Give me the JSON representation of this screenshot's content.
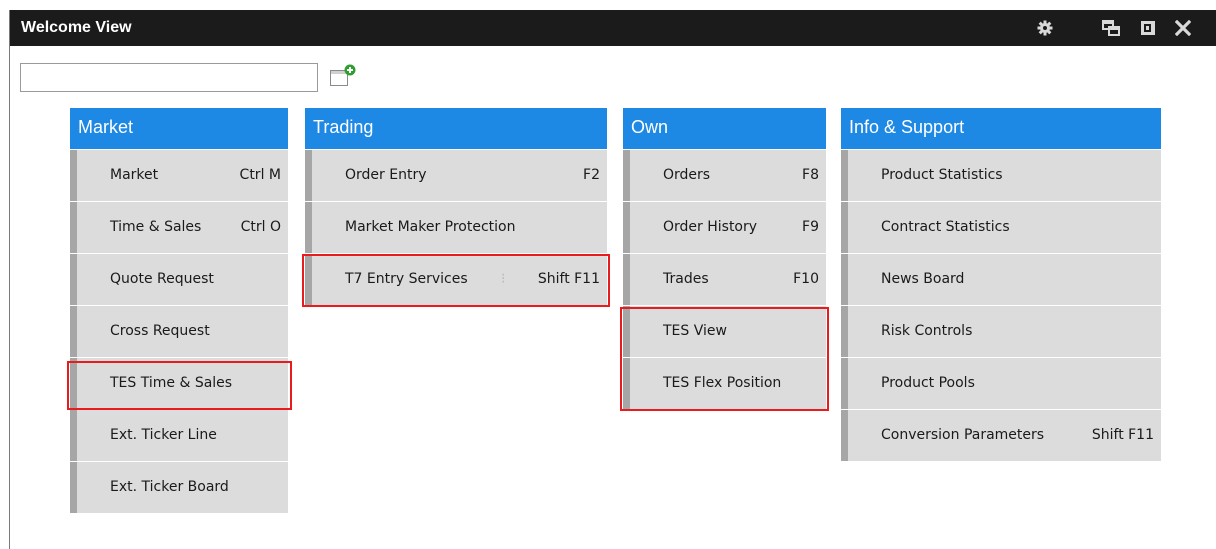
{
  "window": {
    "title": "Welcome View"
  },
  "toolbar": {
    "settings_icon": "gear-icon",
    "restore_icon": "restore-windows-icon",
    "detach_icon": "detach-icon",
    "close_icon": "close-icon",
    "add_icon": "add-view-icon"
  },
  "search": {
    "value": "",
    "placeholder": ""
  },
  "columns": {
    "market": {
      "header": "Market",
      "items": [
        {
          "label": "Market",
          "key": "Ctrl M"
        },
        {
          "label": "Time & Sales",
          "key": "Ctrl O"
        },
        {
          "label": "Quote Request",
          "key": ""
        },
        {
          "label": "Cross Request",
          "key": ""
        },
        {
          "label": "TES Time & Sales",
          "key": ""
        },
        {
          "label": "Ext. Ticker Line",
          "key": ""
        },
        {
          "label": "Ext. Ticker Board",
          "key": ""
        }
      ]
    },
    "trading": {
      "header": "Trading",
      "items": [
        {
          "label": "Order Entry",
          "key": "F2"
        },
        {
          "label": "Market Maker Protection",
          "key": ""
        },
        {
          "label": "T7 Entry Services",
          "key": "Shift F11"
        }
      ]
    },
    "own": {
      "header": "Own",
      "items": [
        {
          "label": "Orders",
          "key": "F8"
        },
        {
          "label": "Order History",
          "key": "F9"
        },
        {
          "label": "Trades",
          "key": "F10"
        },
        {
          "label": "TES View",
          "key": ""
        },
        {
          "label": "TES Flex Position",
          "key": ""
        }
      ]
    },
    "info": {
      "header": "Info & Support",
      "items": [
        {
          "label": "Product Statistics",
          "key": ""
        },
        {
          "label": "Contract Statistics",
          "key": ""
        },
        {
          "label": "News Board",
          "key": ""
        },
        {
          "label": "Risk Controls",
          "key": ""
        },
        {
          "label": "Product Pools",
          "key": ""
        },
        {
          "label": "Conversion Parameters",
          "key": "Shift F11"
        }
      ]
    }
  },
  "colors": {
    "header_blue": "#1e88e5",
    "titlebar": "#1b1b1b",
    "item_bg": "#dcdcdc",
    "highlight_red": "#e81c1c"
  }
}
